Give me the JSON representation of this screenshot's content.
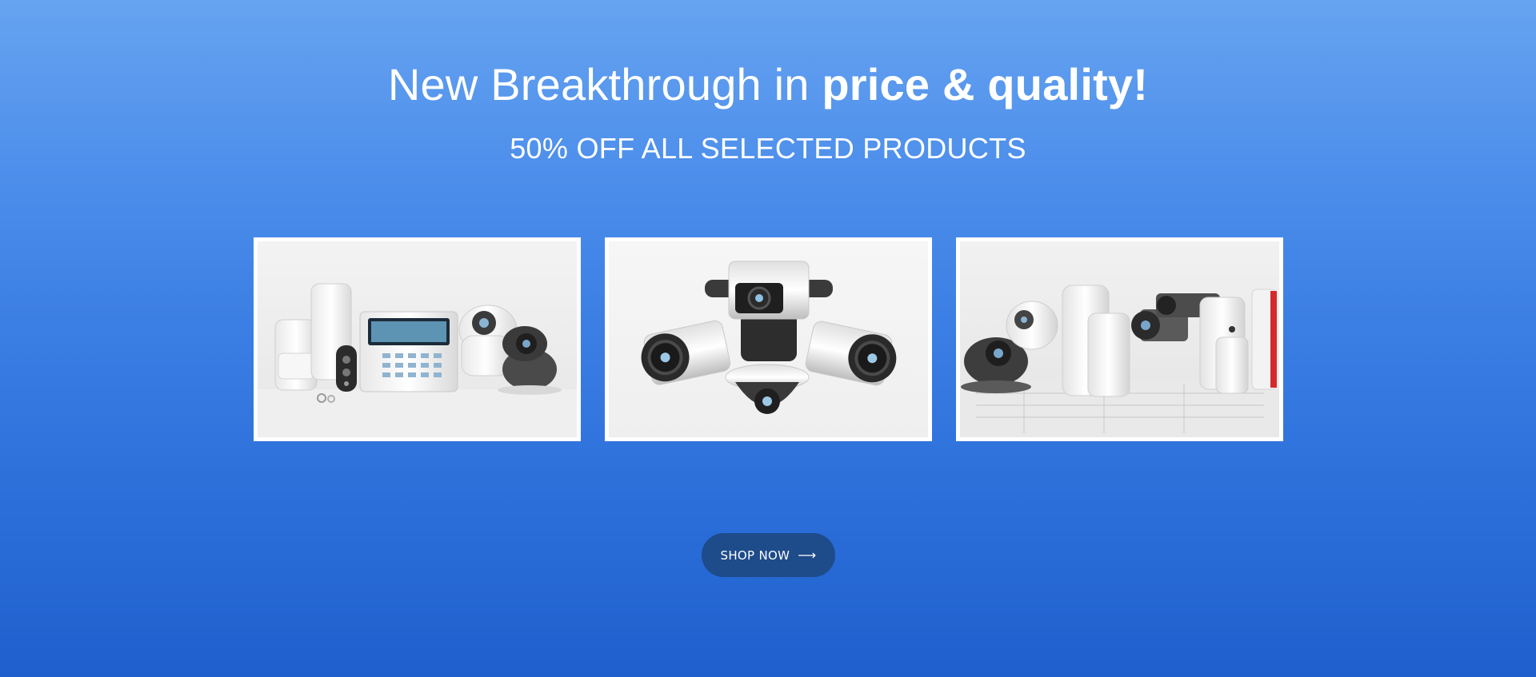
{
  "hero": {
    "headline_regular": "New Breakthrough in ",
    "headline_bold": "price & quality!",
    "subheadline": "50% OFF ALL SELECTED PRODUCTS",
    "cta_label": "SHOP NOW",
    "cta_icon": "arrow-right-icon"
  },
  "products": [
    {
      "image": "alarm-system-kit-photo"
    },
    {
      "image": "cctv-cameras-cluster-photo"
    },
    {
      "image": "sensors-and-cameras-photo"
    }
  ],
  "colors": {
    "background_top": "#66a3f0",
    "background_bottom": "#1f5fcd",
    "button": "#1e4b8a",
    "text": "#ffffff"
  }
}
